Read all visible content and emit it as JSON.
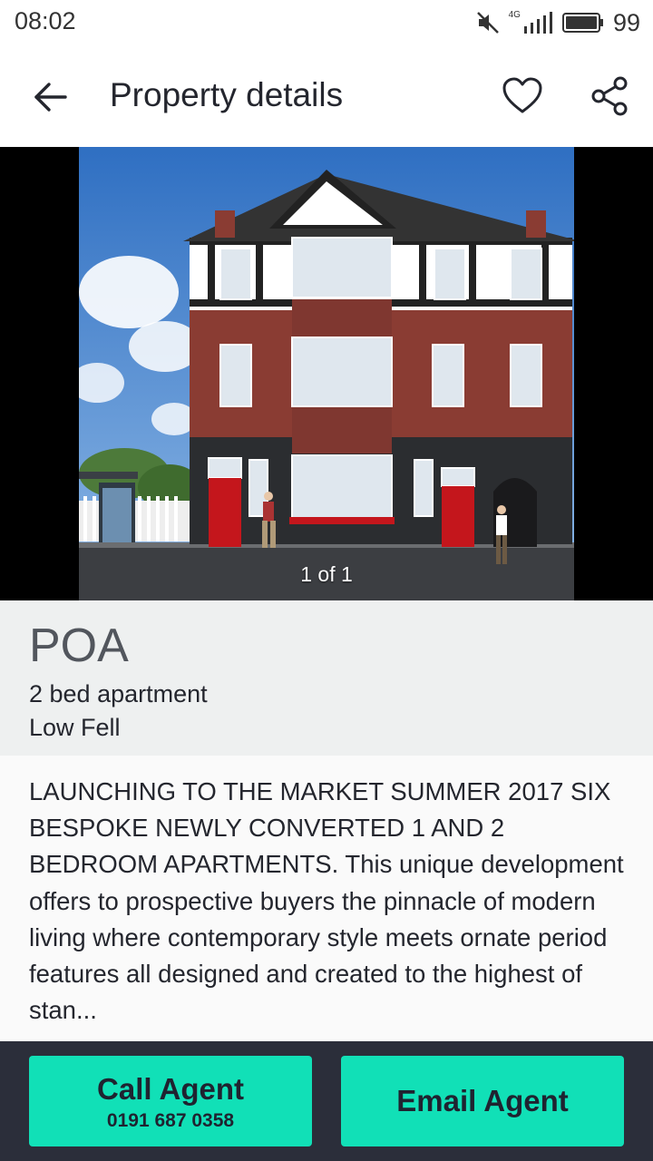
{
  "status_bar": {
    "time": "08:02",
    "network": "4G",
    "battery": "99",
    "icons": [
      "mute-icon",
      "signal-icon",
      "battery-icon"
    ]
  },
  "app_bar": {
    "title": "Property details",
    "icons": [
      "back-arrow-icon",
      "heart-icon",
      "share-icon"
    ]
  },
  "gallery": {
    "counter": "1 of 1"
  },
  "listing": {
    "price": "POA",
    "type": "2 bed apartment",
    "location": "Low Fell",
    "description": "LAUNCHING TO THE MARKET SUMMER 2017 SIX BESPOKE NEWLY CONVERTED 1 AND 2 BEDROOM APARTMENTS. This unique development offers to prospective buyers the pinnacle of modern living where contemporary style meets ornate period features all designed and created to the highest of stan..."
  },
  "actions": {
    "call_label": "Call Agent",
    "call_number": "0191 687 0358",
    "email_label": "Email Agent"
  },
  "colors": {
    "accent": "#11e0b7",
    "action_bar_bg": "#2b2e3a",
    "summary_bg": "#eef0f0",
    "text": "#24262e"
  }
}
